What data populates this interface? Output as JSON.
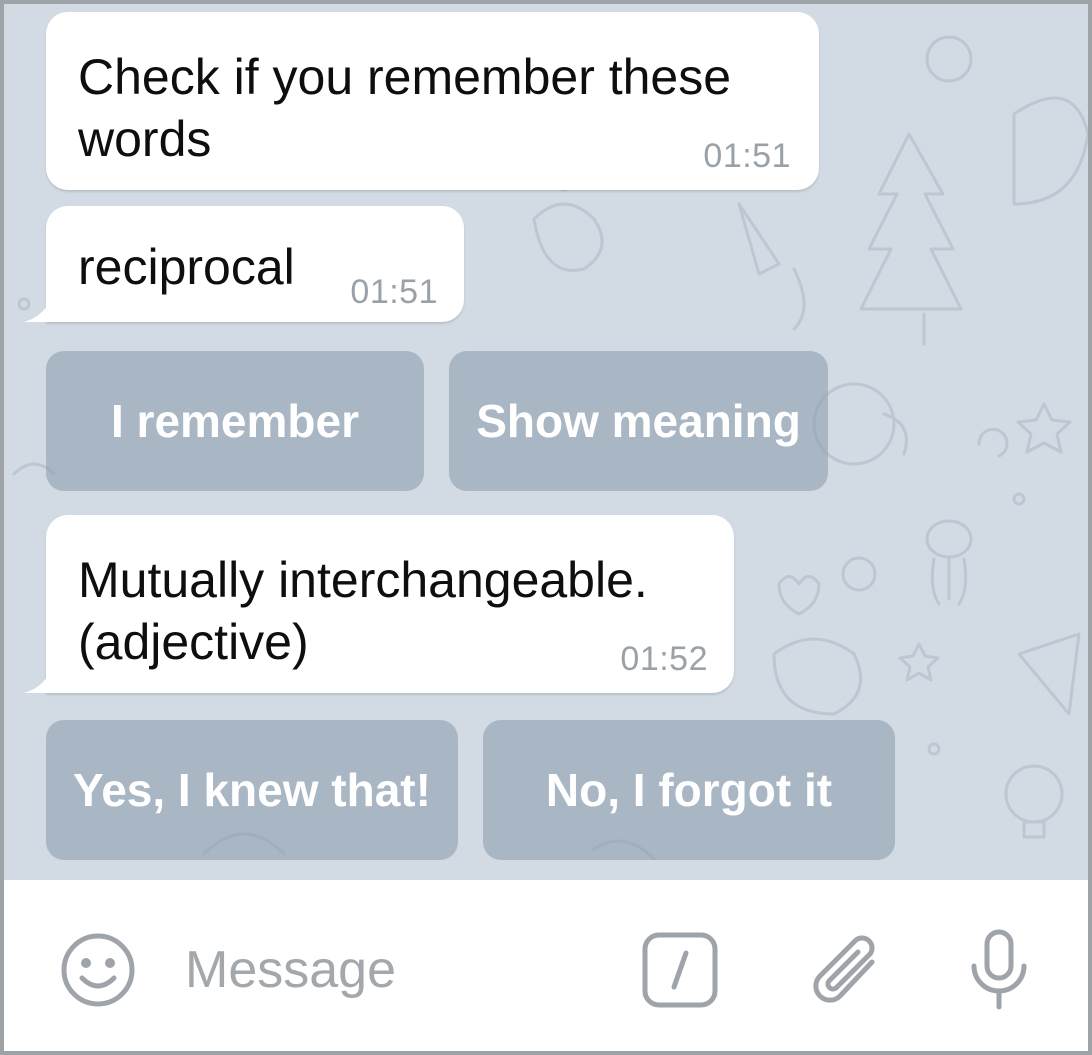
{
  "messages": [
    {
      "text": "Check if you remember these\nwords",
      "time": "01:51"
    },
    {
      "text": "reciprocal",
      "time": "01:51"
    },
    {
      "text": "Mutually interchangeable.\n(adjective)",
      "time": "01:52"
    }
  ],
  "keyboards": {
    "first": {
      "remember": "I remember",
      "show_meaning": "Show meaning"
    },
    "second": {
      "knew": "Yes, I knew that!",
      "forgot": "No, I forgot it"
    }
  },
  "composer": {
    "placeholder": "Message",
    "icons": [
      "emoji-icon",
      "bot-command-icon",
      "attach-icon",
      "microphone-icon"
    ]
  },
  "colors": {
    "chat_background": "#d2dbe3",
    "bubble": "#ffffff",
    "keyboard_button": "#a0aebb",
    "time_text": "#9aa2a9",
    "icon": "#9ea4aa"
  }
}
